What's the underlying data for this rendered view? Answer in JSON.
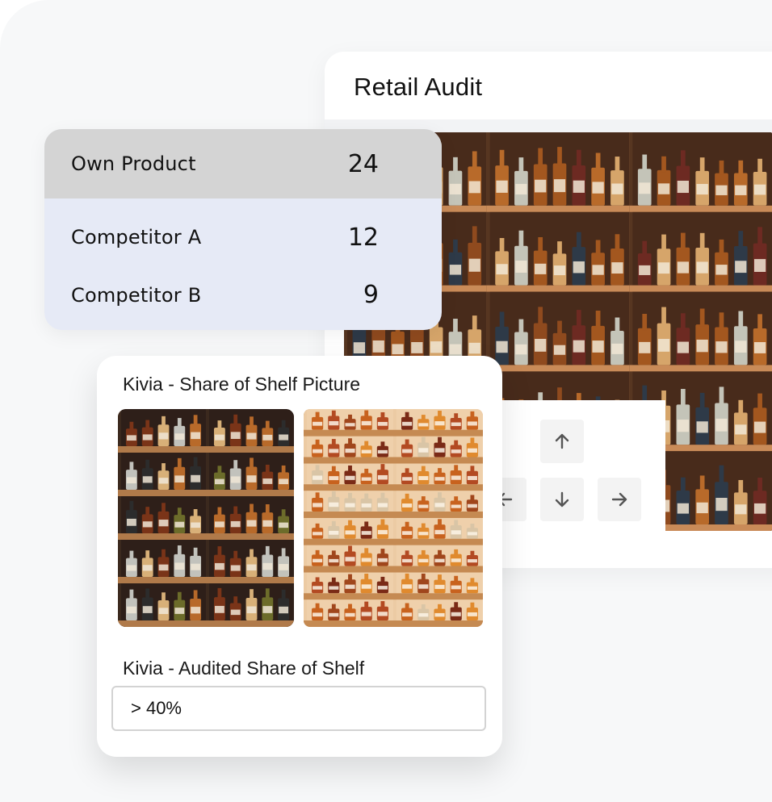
{
  "audit": {
    "title": "Retail Audit"
  },
  "counts": {
    "rows": [
      {
        "label": "Own Product",
        "value": "24"
      },
      {
        "label": "Competitor A",
        "value": "12"
      },
      {
        "label": "Competitor B",
        "value": "9"
      }
    ],
    "colors": {
      "own_row": "#d4d4d4",
      "other_rows": "#e6eaf6"
    }
  },
  "share": {
    "picture_title": "Kivia - Share of Shelf Picture",
    "audited_title": "Kivia - Audited Share of Shelf",
    "audited_value": "> 40%"
  },
  "controls": {
    "icons": [
      "arrow-up-icon",
      "arrow-left-icon",
      "arrow-down-icon",
      "arrow-right-icon"
    ]
  }
}
